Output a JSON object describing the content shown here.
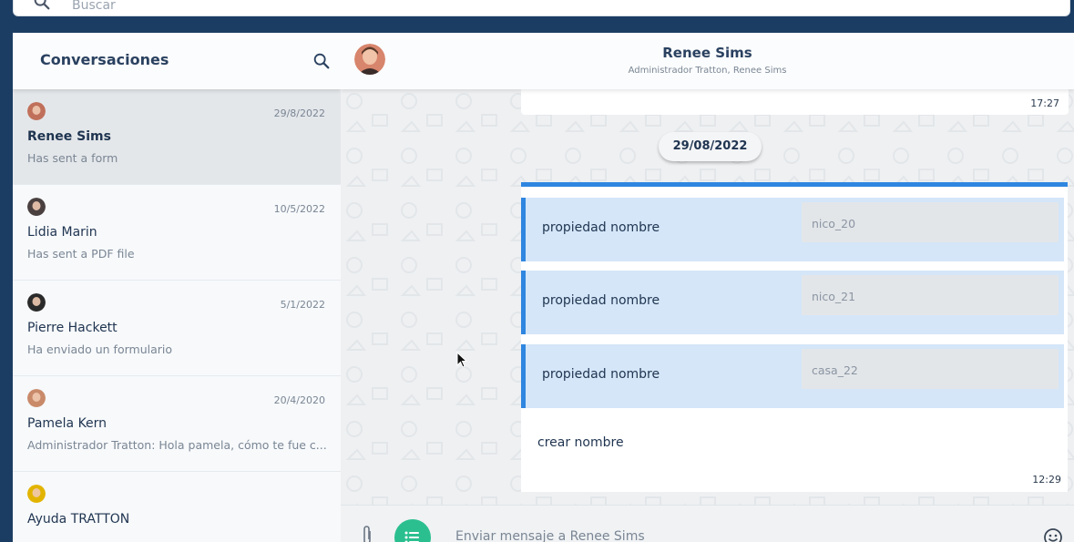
{
  "search": {
    "placeholder": "Buscar"
  },
  "sidebar": {
    "title": "Conversaciones",
    "conversations": [
      {
        "name": "Renee Sims",
        "date": "29/8/2022",
        "preview": "Has sent a form",
        "active": true,
        "avatar_color": "#c0705a"
      },
      {
        "name": "Lidia Marin",
        "date": "10/5/2022",
        "preview": "Has sent a PDF file",
        "active": false,
        "avatar_color": "#4a4040"
      },
      {
        "name": "Pierre Hackett",
        "date": "5/1/2022",
        "preview": "Ha enviado un formulario",
        "active": false,
        "avatar_color": "#2a2a2a"
      },
      {
        "name": "Pamela Kern",
        "date": "20/4/2020",
        "preview": "Administrador Tratton: Hola pamela, cómo te fue c...",
        "active": false,
        "avatar_color": "#c98a6a"
      },
      {
        "name": "Ayuda TRATTON",
        "date": "",
        "preview": "",
        "active": false,
        "avatar_color": "#e2b400"
      }
    ]
  },
  "chat": {
    "contact_name": "Renee Sims",
    "participants": "Administrador Tratton, Renee Sims",
    "previous_message_time": "17:27",
    "date_separator": "29/08/2022",
    "form": {
      "fields": [
        {
          "label": "propiedad nombre",
          "value": "nico_20"
        },
        {
          "label": "propiedad nombre",
          "value": "nico_21"
        },
        {
          "label": "propiedad nombre",
          "value": "casa_22"
        }
      ],
      "footer": "crear nombre",
      "time": "12:29"
    },
    "composer_placeholder": "Enviar mensaje a Renee Sims"
  },
  "colors": {
    "accent": "#2f86e0",
    "green": "#2bbf8f",
    "navy": "#1c3d63"
  }
}
